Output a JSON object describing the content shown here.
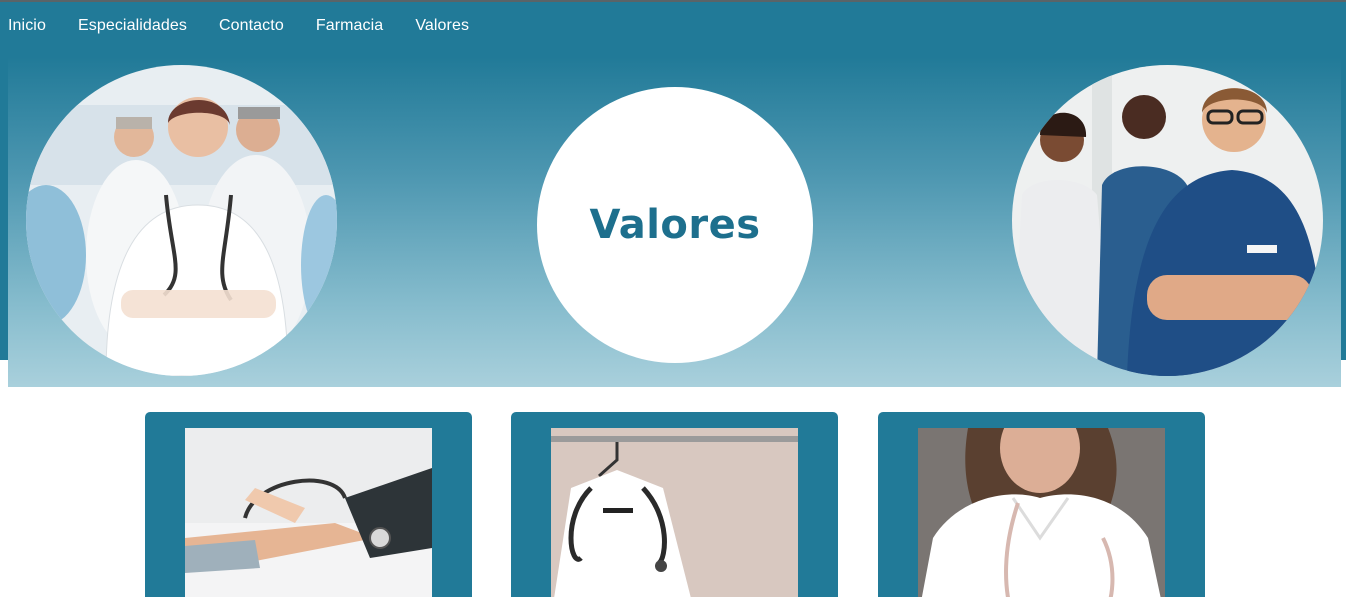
{
  "nav": {
    "items": [
      "Inicio",
      "Especialidades",
      "Contacto",
      "Farmacia",
      "Valores"
    ]
  },
  "hero": {
    "title": "Valores",
    "left_image": "group-of-doctors-photo",
    "right_image": "medical-team-photo"
  },
  "cards": [
    {
      "image": "blood-pressure-check-photo"
    },
    {
      "image": "doctor-coat-stethoscope-photo"
    },
    {
      "image": "female-doctor-photo"
    }
  ],
  "colors": {
    "primary": "#217a98",
    "title": "#1d6f8d",
    "hero_bottom": "#a9d0dc"
  }
}
